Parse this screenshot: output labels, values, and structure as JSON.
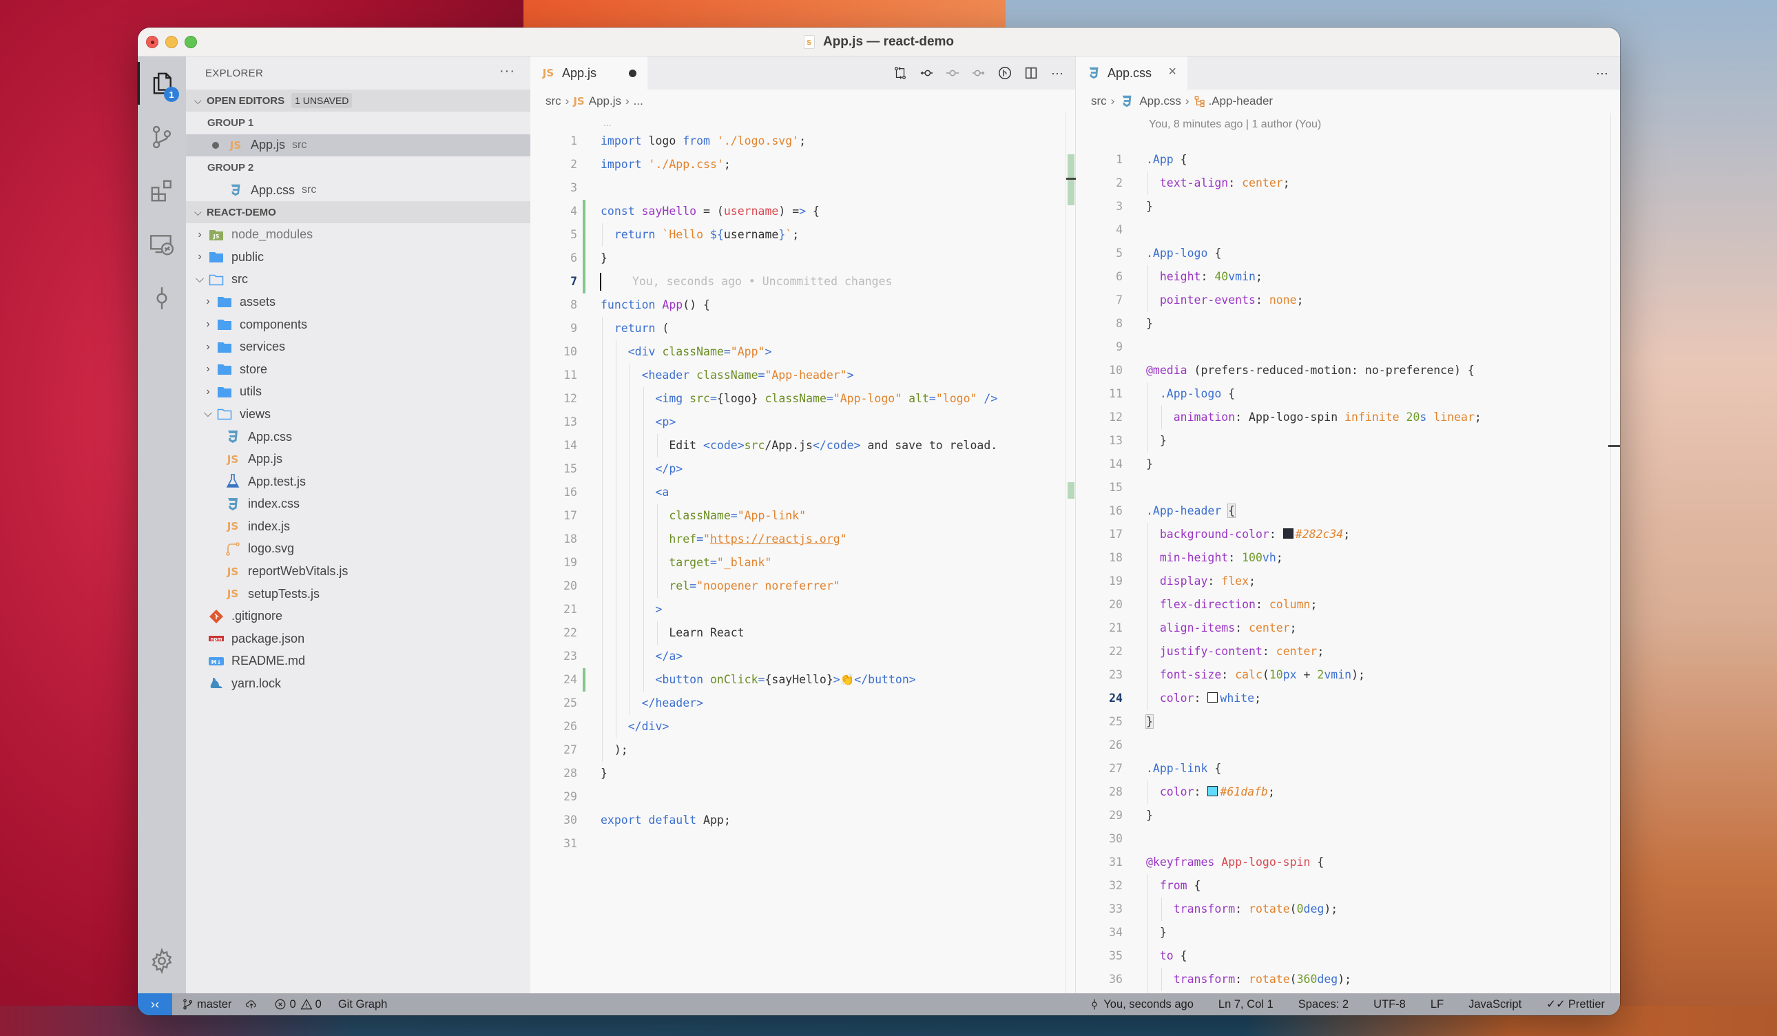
{
  "window": {
    "title": "App.js — react-demo"
  },
  "activity_bar": {
    "explorer_badge": "1",
    "items": [
      "explorer",
      "source-control",
      "extensions",
      "remote-explorer",
      "git-graph",
      "settings"
    ]
  },
  "sidebar": {
    "title": "EXPLORER",
    "more": "···",
    "open_editors": {
      "label": "OPEN EDITORS",
      "badge": "1 UNSAVED",
      "groups": [
        {
          "label": "GROUP 1",
          "file": "App.js",
          "desc": "src",
          "icon": "js",
          "dirty": true
        },
        {
          "label": "GROUP 2",
          "file": "App.css",
          "desc": "src",
          "icon": "css",
          "dirty": false
        }
      ]
    },
    "project": {
      "label": "REACT-DEMO",
      "tree": [
        {
          "name": "node_modules",
          "type": "node-folder",
          "depth": 0,
          "expanded": false
        },
        {
          "name": "public",
          "type": "folder",
          "depth": 0,
          "expanded": false
        },
        {
          "name": "src",
          "type": "folder-open",
          "depth": 0,
          "expanded": true
        },
        {
          "name": "assets",
          "type": "folder",
          "depth": 1,
          "expanded": false
        },
        {
          "name": "components",
          "type": "folder",
          "depth": 1,
          "expanded": false
        },
        {
          "name": "services",
          "type": "folder",
          "depth": 1,
          "expanded": false
        },
        {
          "name": "store",
          "type": "folder",
          "depth": 1,
          "expanded": false
        },
        {
          "name": "utils",
          "type": "folder",
          "depth": 1,
          "expanded": false
        },
        {
          "name": "views",
          "type": "folder-open",
          "depth": 1,
          "expanded": true
        },
        {
          "name": "App.css",
          "type": "css",
          "depth": 1
        },
        {
          "name": "App.js",
          "type": "js",
          "depth": 1
        },
        {
          "name": "App.test.js",
          "type": "test",
          "depth": 1
        },
        {
          "name": "index.css",
          "type": "css",
          "depth": 1
        },
        {
          "name": "index.js",
          "type": "js",
          "depth": 1
        },
        {
          "name": "logo.svg",
          "type": "svg",
          "depth": 1
        },
        {
          "name": "reportWebVitals.js",
          "type": "js",
          "depth": 1
        },
        {
          "name": "setupTests.js",
          "type": "js",
          "depth": 1
        },
        {
          "name": ".gitignore",
          "type": "git",
          "depth": 0
        },
        {
          "name": "package.json",
          "type": "npm",
          "depth": 0
        },
        {
          "name": "README.md",
          "type": "md",
          "depth": 0
        },
        {
          "name": "yarn.lock",
          "type": "yarn",
          "depth": 0
        }
      ]
    }
  },
  "editor_left": {
    "tab": {
      "label": "App.js",
      "icon": "JS",
      "dirty": true
    },
    "actions": [
      "open-changes-icon",
      "previous-change-icon",
      "commit-icon",
      "next-change-icon",
      "git-graph-icon",
      "split-editor-icon",
      "more-actions-icon"
    ],
    "breadcrumb": {
      "folder": "src",
      "icon": "JS",
      "file": "App.js",
      "rest": "..."
    },
    "fold_hint": "...",
    "blame_inline": "You, seconds ago • Uncommitted changes",
    "current_line": 7,
    "lines": [
      "import logo from './logo.svg';",
      "import './App.css';",
      "",
      "const sayHello = (username) => {",
      "  return `Hello ${username}`;",
      "}",
      "",
      "function App() {",
      "  return (",
      "    <div className=\"App\">",
      "      <header className=\"App-header\">",
      "        <img src={logo} className=\"App-logo\" alt=\"logo\" />",
      "        <p>",
      "          Edit <code>src/App.js</code> and save to reload.",
      "        </p>",
      "        <a",
      "          className=\"App-link\"",
      "          href=\"https://reactjs.org\"",
      "          target=\"_blank\"",
      "          rel=\"noopener noreferrer\"",
      "        >",
      "          Learn React",
      "        </a>",
      "        <button onClick={sayHello}>👏</button>",
      "      </header>",
      "    </div>",
      "  );",
      "}",
      "",
      "export default App;",
      ""
    ]
  },
  "editor_right": {
    "tab": {
      "label": "App.css",
      "icon": "css"
    },
    "more": "···",
    "breadcrumb": {
      "folder": "src",
      "file": "App.css",
      "symbol": ".App-header"
    },
    "codelens": "You, 8 minutes ago | 1 author (You)",
    "current_line": 24,
    "colors": {
      "background": "#282c34",
      "white": "#ffffff",
      "link": "#61dafb"
    },
    "lines": [
      ".App {",
      "  text-align: center;",
      "}",
      "",
      ".App-logo {",
      "  height: 40vmin;",
      "  pointer-events: none;",
      "}",
      "",
      "@media (prefers-reduced-motion: no-preference) {",
      "  .App-logo {",
      "    animation: App-logo-spin infinite 20s linear;",
      "  }",
      "}",
      "",
      ".App-header {",
      "  background-color: #282c34;",
      "  min-height: 100vh;",
      "  display: flex;",
      "  flex-direction: column;",
      "  align-items: center;",
      "  justify-content: center;",
      "  font-size: calc(10px + 2vmin);",
      "  color: white;",
      "}",
      "",
      ".App-link {",
      "  color: #61dafb;",
      "}",
      "",
      "@keyframes App-logo-spin {",
      "  from {",
      "    transform: rotate(0deg);",
      "  }",
      "  to {",
      "    transform: rotate(360deg);",
      "  }"
    ]
  },
  "status_bar": {
    "remote_icon": "remote-icon",
    "branch": "master",
    "errors": "0",
    "warnings": "0",
    "git_graph": "Git Graph",
    "blame": "You, seconds ago",
    "position": "Ln 7, Col 1",
    "indent": "Spaces: 2",
    "encoding": "UTF-8",
    "eol": "LF",
    "language": "JavaScript",
    "formatter": "Prettier"
  }
}
